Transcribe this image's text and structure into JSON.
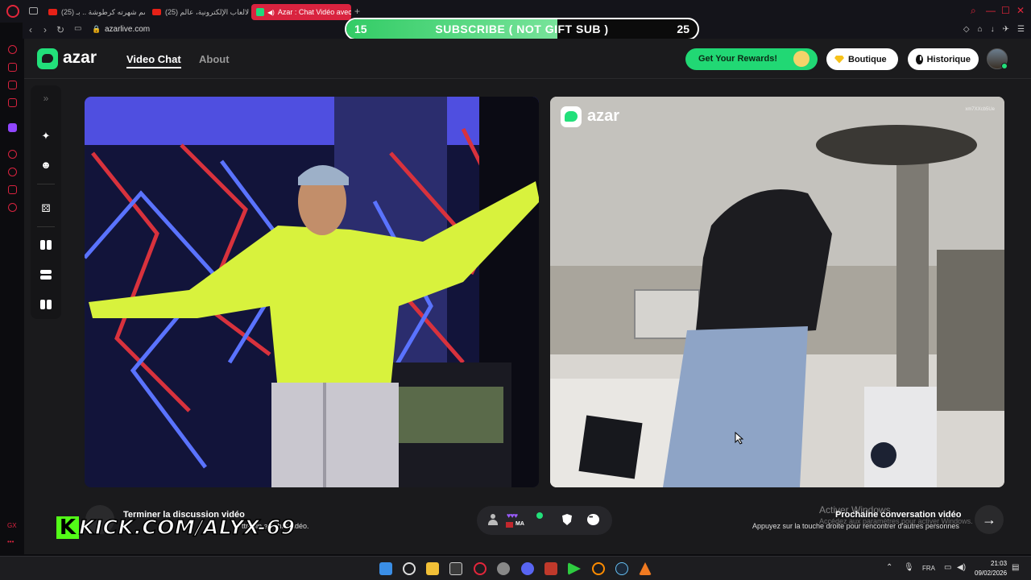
{
  "browser": {
    "tabs": [
      {
        "label": "(25) إسم شهرته كرطوشة .. بـ"
      },
      {
        "label": "(25) الالعاب الإلكترونية، عالم"
      },
      {
        "label": "Azar : Chat Vidéo avec"
      }
    ],
    "new_tab_symbol": "+",
    "url": "azarlive.com"
  },
  "overlay": {
    "sub_goal_current": "15",
    "sub_goal_title": "SUBSCRIBE ( NOT GIFT SUB )",
    "sub_goal_target": "25",
    "progress_fraction": 0.6,
    "kick_letter": "K",
    "kick_url": "KICK.COM/ALYX-69"
  },
  "app": {
    "logo": "azar",
    "nav": {
      "video_chat": "Video Chat",
      "about": "About"
    },
    "rewards_label": "Get Your Rewards!",
    "boutique_label": "Boutique",
    "historique_label": "Historique",
    "accent_color": "#22e07a"
  },
  "video": {
    "remote_watermark": "azar",
    "remote_id": "xm7XXcb5Ue"
  },
  "bottom": {
    "end_title": "Terminer la discussion vidéo",
    "end_sub": "ttre fin au chat vidéo.",
    "partner_country": "MA",
    "next_title": "Prochaine conversation vidéo",
    "next_sub": "Appuyez sur la touche droite pour rencontrer d'autres personnes",
    "windows_activate": "Activer Windows",
    "windows_activate_sub": "Accédez aux paramètres pour activer Windows.",
    "next_arrow": "→"
  },
  "taskbar": {
    "language": "FRA",
    "time": "21:03",
    "date": "09/02/2026"
  }
}
